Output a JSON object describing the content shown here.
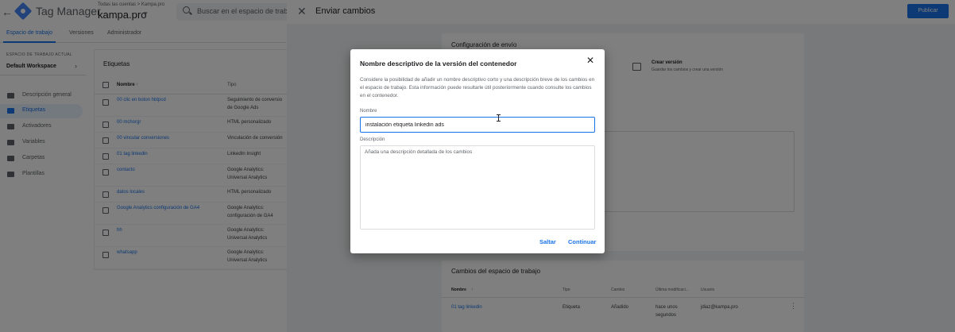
{
  "app": {
    "product": "Tag Manager",
    "breadcrumb": "Todas las cuentas > Kampa.pro",
    "container": "kampa.pro",
    "search_placeholder": "Buscar en el espacio de trabajo",
    "nav_tabs": [
      "Espacio de trabajo",
      "Versiones",
      "Administrador"
    ],
    "workspace_label": "ESPACIO DE TRABAJO ACTUAL",
    "workspace_name": "Default Workspace",
    "sidebar": [
      {
        "label": "Descripción general",
        "icon": "overview-icon"
      },
      {
        "label": "Etiquetas",
        "icon": "tag-icon",
        "active": true
      },
      {
        "label": "Activadores",
        "icon": "trigger-icon"
      },
      {
        "label": "Variables",
        "icon": "variables-icon"
      },
      {
        "label": "Carpetas",
        "icon": "folder-icon"
      },
      {
        "label": "Plantillas",
        "icon": "template-icon"
      }
    ]
  },
  "tags": {
    "title": "Etiquetas",
    "col_name": "Nombre",
    "col_type": "Tipo",
    "rows": [
      {
        "name": "00 clic en boton hbtpcd",
        "type": "Seguimiento de conversio | de Google Ads"
      },
      {
        "name": "00 mchorgr",
        "type": "HTML personalizado"
      },
      {
        "name": "00 vincular conversiones",
        "type": "Vinculación de conversión"
      },
      {
        "name": "01 tag linkedin",
        "type": "LinkedIn Insight"
      },
      {
        "name": "contacto",
        "type": "Google Analytics: | Universal Analytics"
      },
      {
        "name": "datos locales",
        "type": "HTML personalizado"
      },
      {
        "name": "Google Analytics configuración de GA4",
        "type": "Google Analytics: | configuración de GA4"
      },
      {
        "name": "hh",
        "type": "Google Analytics: | Universal Analytics"
      },
      {
        "name": "whatsapp",
        "type": "Google Analytics: | Universal Analytics"
      }
    ]
  },
  "submit": {
    "title": "Enviar cambios",
    "publish_label": "Publicar",
    "config_title": "Configuración de envío",
    "create_version_title": "Crear versión",
    "create_version_sub": "Guardar los cambios y crear una versión",
    "changes_title": "Cambios del espacio de trabajo",
    "changes_headers": [
      "Nombre",
      "Tipo",
      "Cambio",
      "Última modificaci...",
      "Usuario"
    ],
    "changes_rows": [
      {
        "name": "01 tag linkedin",
        "type": "Etiqueta",
        "change": "Añadido",
        "modified": "hace unos | segundos",
        "user": "jdiaz@kampa.pro"
      }
    ]
  },
  "dialog": {
    "title": "Nombre descriptivo de la versión del contenedor",
    "description": "Considere la posibilidad de añadir un nombre descriptivo corto y una descripción breve de los cambios en el espacio de trabajo. Esta información puede resultarle útil posteriormente cuando consulte los cambios en el contenedor.",
    "name_label": "Nombre",
    "name_value": "instalación etiqueta linkedin ads",
    "description_label": "Descripción",
    "description_placeholder": "Añada una descripción detallada de los cambios",
    "skip_label": "Saltar",
    "continue_label": "Continuar"
  },
  "colors": {
    "accent": "#1a73e8",
    "scrim": "rgba(0,0,0,0.5)"
  }
}
